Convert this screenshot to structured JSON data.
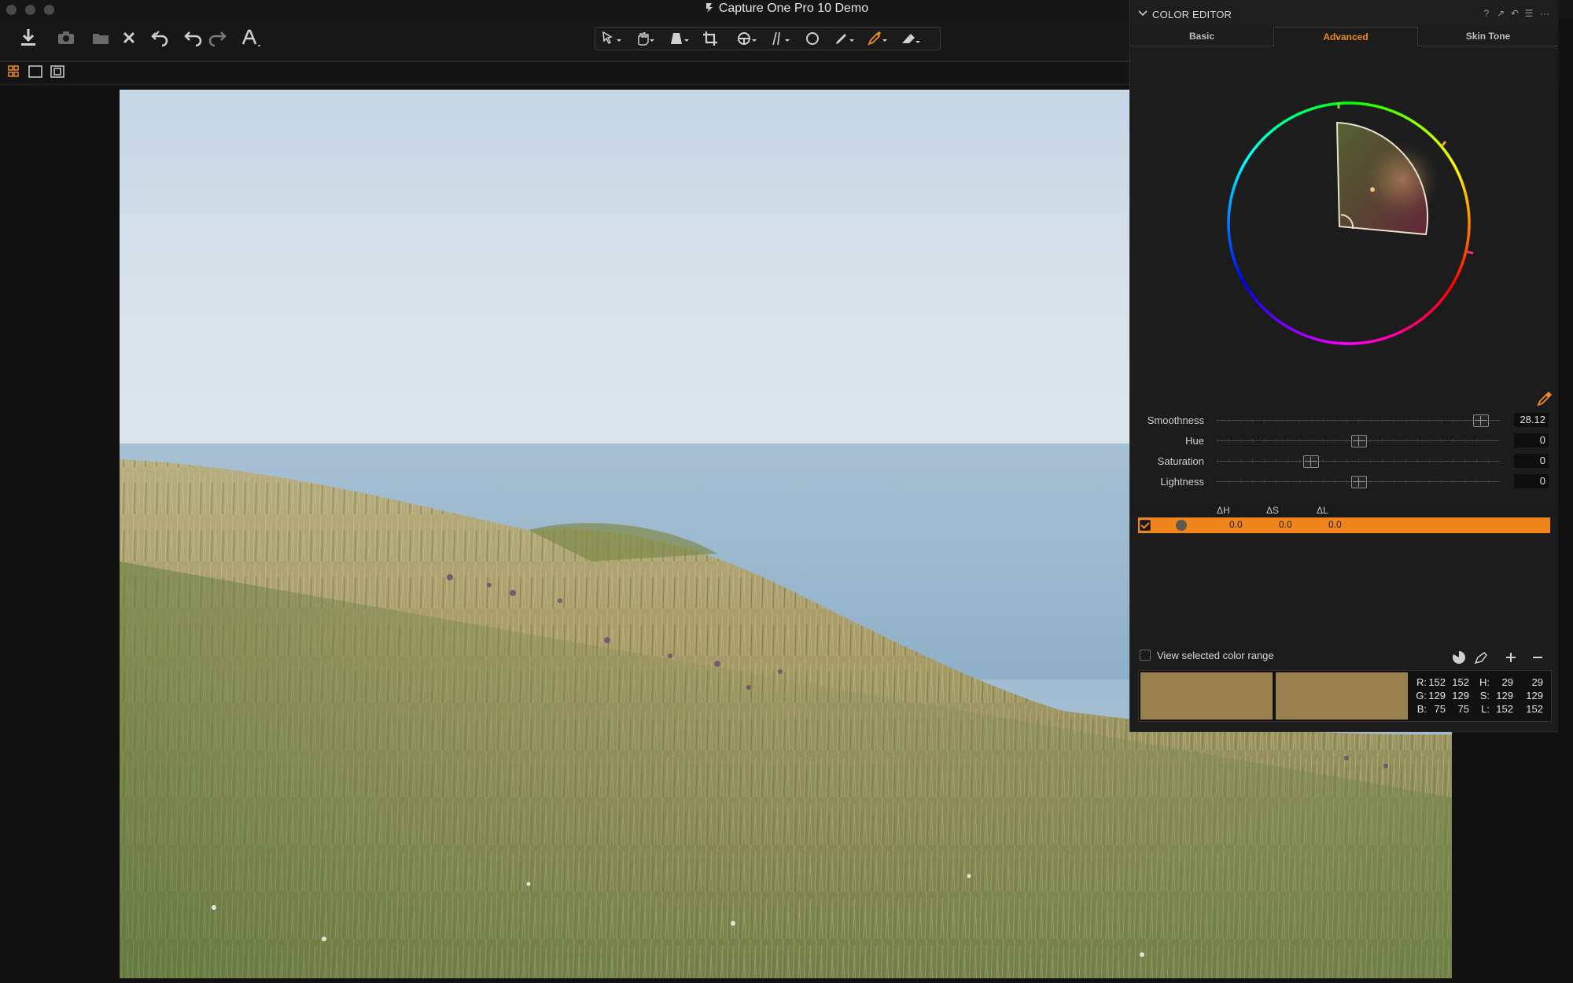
{
  "window": {
    "title": "Capture One Pro 10 Demo"
  },
  "toolbar": {
    "left_icons": [
      "import-icon",
      "camera-icon",
      "folder-icon",
      "close-icon",
      "undo-history-icon",
      "undo-icon",
      "redo-icon",
      "text-overlay-icon"
    ],
    "cursor_tools": [
      "select-cursor-icon",
      "pan-hand-icon",
      "keystone-icon",
      "crop-icon",
      "rotate-icon",
      "straighten-icon",
      "circle-spot-icon",
      "brush-icon",
      "color-picker-icon",
      "eraser-icon"
    ]
  },
  "viewbar": {
    "modes": [
      "grid-view-icon",
      "single-view-icon",
      "compare-view-icon"
    ]
  },
  "color_editor": {
    "title": "COLOR EDITOR",
    "header_icons": [
      "?",
      "↗",
      "↶",
      "☰",
      "···"
    ],
    "tabs": [
      {
        "label": "Basic",
        "active": false
      },
      {
        "label": "Advanced",
        "active": true
      },
      {
        "label": "Skin Tone",
        "active": false
      }
    ],
    "sliders": [
      {
        "label": "Smoothness",
        "value": "28.12",
        "position": 0.93
      },
      {
        "label": "Hue",
        "value": "0",
        "position": 0.5
      },
      {
        "label": "Saturation",
        "value": "0",
        "position": 0.33
      },
      {
        "label": "Lightness",
        "value": "0",
        "position": 0.5
      }
    ],
    "delta_headers": [
      "ΔH",
      "ΔS",
      "ΔL"
    ],
    "range": {
      "checked": true,
      "dh": "0.0",
      "ds": "0.0",
      "dl": "0.0",
      "swatch_color": "#5e5850",
      "row_color": "#f0861b"
    },
    "view_selected_label": "View selected color range",
    "view_selected_checked": false,
    "swatch_color": "#987f4b",
    "readout": {
      "rows": [
        {
          "ch1": "R:",
          "a": "152",
          "b": "152",
          "ch2": "H:",
          "c": "29",
          "d": "29"
        },
        {
          "ch1": "G:",
          "a": "129",
          "b": "129",
          "ch2": "S:",
          "c": "129",
          "d": "129"
        },
        {
          "ch1": "B:",
          "a": "75",
          "b": "75",
          "ch2": "L:",
          "c": "152",
          "d": "152"
        }
      ]
    }
  },
  "colors": {
    "accent": "#f08a22",
    "panel_bg": "#1c1c1c",
    "app_bg": "#121212"
  }
}
